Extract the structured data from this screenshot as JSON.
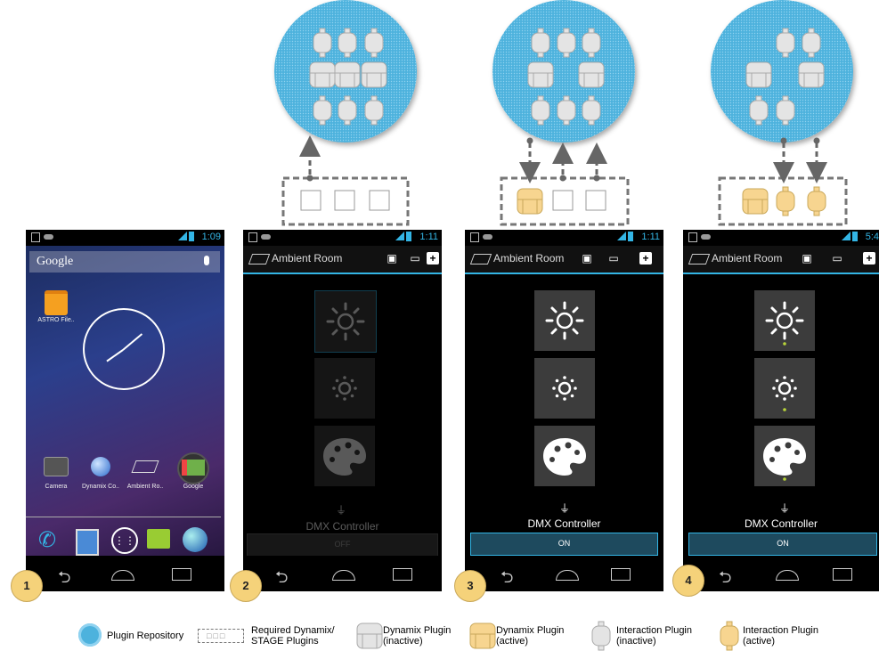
{
  "colors": {
    "accent": "#33b5e5",
    "repo_blue": "#4db2dd",
    "active_plugin": "#f7d590",
    "inactive_plugin": "#e4e4e4",
    "badge": "#f5d27a"
  },
  "phone1": {
    "time": "1:09",
    "search_text": "Google",
    "app_astro": "ASTRO File..",
    "dock_apps": [
      "Camera",
      "Dynamix Co..",
      "Ambient Ro..",
      "Google"
    ]
  },
  "phone2": {
    "time": "1:11",
    "title": "Ambient Room",
    "controller_label": "DMX Controller",
    "button_label": "OFF"
  },
  "phone3": {
    "time": "1:11",
    "title": "Ambient Room",
    "controller_label": "DMX Controller",
    "button_label": "ON"
  },
  "phone4": {
    "time": "5:4",
    "title": "Ambient Room",
    "controller_label": "DMX Controller",
    "button_label": "ON"
  },
  "steps": [
    "1",
    "2",
    "3",
    "4"
  ],
  "legend": {
    "repository": "Plugin Repository",
    "required_1": "Required Dynamix/",
    "required_2": "STAGE Plugins",
    "dyn_inactive_1": "Dynamix Plugin",
    "dyn_inactive_2": "(inactive)",
    "dyn_active_1": "Dynamix Plugin",
    "dyn_active_2": "(active)",
    "int_inactive_1": "Interaction Plugin",
    "int_inactive_2": "(inactive)",
    "int_active_1": "Interaction Plugin",
    "int_active_2": "(active)"
  }
}
